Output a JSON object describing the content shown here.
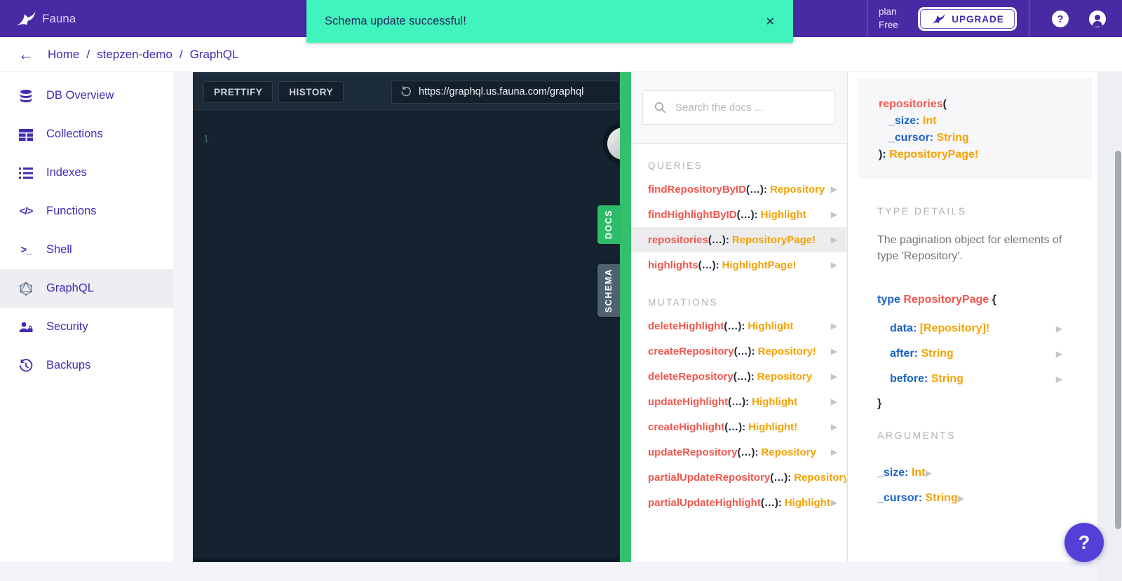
{
  "colors": {
    "topbar_purple": "#4929a4",
    "toast_green": "#41f3bd",
    "toast_text": "#232a5e",
    "link_purple": "#3e2db3",
    "editor_bg": "#15222f",
    "toolbar_bg": "#1d2c3b",
    "divider_green": "#31c16d",
    "docs_tab_green": "#2dbd69",
    "schema_tab_slate": "#4e6272",
    "field_red": "#f2574e",
    "type_orange": "#f5a202",
    "keyword_blue": "#1a63c5",
    "punct_dark": "#202b38",
    "muted_gray": "#b1b1b1",
    "fab_purple": "#5340d9"
  },
  "topbar": {
    "brand": "Fauna",
    "plan_label": "plan",
    "plan_value": "Free",
    "upgrade_label": "UPGRADE",
    "help_icon": "?"
  },
  "toast": {
    "message": "Schema update successful!",
    "close": "✕"
  },
  "breadcrumb": {
    "back": "←",
    "separator": "/",
    "items": [
      "Home",
      "stepzen-demo",
      "GraphQL"
    ]
  },
  "sidebar": {
    "items": [
      {
        "label": "DB Overview",
        "icon": "database-icon"
      },
      {
        "label": "Collections",
        "icon": "collections-icon"
      },
      {
        "label": "Indexes",
        "icon": "indexes-icon"
      },
      {
        "label": "Functions",
        "icon": "functions-icon",
        "glyph": "</>"
      },
      {
        "label": "Shell",
        "icon": "shell-icon",
        "glyph": ">_"
      },
      {
        "label": "GraphQL",
        "icon": "graphql-icon",
        "selected": true
      },
      {
        "label": "Security",
        "icon": "security-icon"
      },
      {
        "label": "Backups",
        "icon": "backups-icon"
      }
    ]
  },
  "editor": {
    "prettify_label": "PRETTIFY",
    "history_label": "HISTORY",
    "url": "https://graphql.us.fauna.com/graphql",
    "line_number": "1"
  },
  "side_tabs": {
    "docs": "DOCS",
    "schema": "SCHEMA"
  },
  "docs_panel": {
    "search_placeholder": "Search the docs ...",
    "sections": [
      {
        "title": "QUERIES",
        "items": [
          {
            "name": "findRepositoryByID",
            "args": "(…):",
            "type": "Repository"
          },
          {
            "name": "findHighlightByID",
            "args": "(…):",
            "type": "Highlight"
          },
          {
            "name": "repositories",
            "args": "(…):",
            "type": "RepositoryPage!",
            "selected": true
          },
          {
            "name": "highlights",
            "args": "(…):",
            "type": "HighlightPage!"
          }
        ]
      },
      {
        "title": "MUTATIONS",
        "items": [
          {
            "name": "deleteHighlight",
            "args": "(…):",
            "type": "Highlight"
          },
          {
            "name": "createRepository",
            "args": "(…):",
            "type": "Repository!"
          },
          {
            "name": "deleteRepository",
            "args": "(…):",
            "type": "Repository"
          },
          {
            "name": "updateHighlight",
            "args": "(…):",
            "type": "Highlight"
          },
          {
            "name": "createHighlight",
            "args": "(…):",
            "type": "Highlight!"
          },
          {
            "name": "updateRepository",
            "args": "(…):",
            "type": "Repository"
          },
          {
            "name": "partialUpdateRepository",
            "args": "(…):",
            "type": "Repository"
          },
          {
            "name": "partialUpdateHighlight",
            "args": "(…):",
            "type": "Highlight"
          }
        ]
      }
    ]
  },
  "detail_panel": {
    "signature": {
      "name": "repositories",
      "open_paren": "(",
      "args": [
        {
          "name": "_size",
          "colon": ":",
          "type": "Int"
        },
        {
          "name": "_cursor",
          "colon": ":",
          "type": "String"
        }
      ],
      "close_paren": "):",
      "return_type": "RepositoryPage!"
    },
    "type_details": {
      "heading": "TYPE DETAILS",
      "description": "The pagination object for elements of type 'Repository'.",
      "keyword": "type",
      "type_name": "RepositoryPage",
      "open_brace": "{",
      "fields": [
        {
          "name": "data",
          "colon": ":",
          "type": "[Repository]!"
        },
        {
          "name": "after",
          "colon": ":",
          "type": "String"
        },
        {
          "name": "before",
          "colon": ":",
          "type": "String"
        }
      ],
      "close_brace": "}"
    },
    "arguments": {
      "heading": "ARGUMENTS",
      "items": [
        {
          "name": "_size",
          "colon": ":",
          "type": "Int"
        },
        {
          "name": "_cursor",
          "colon": ":",
          "type": "String"
        }
      ]
    }
  },
  "help_fab": {
    "label": "?"
  }
}
